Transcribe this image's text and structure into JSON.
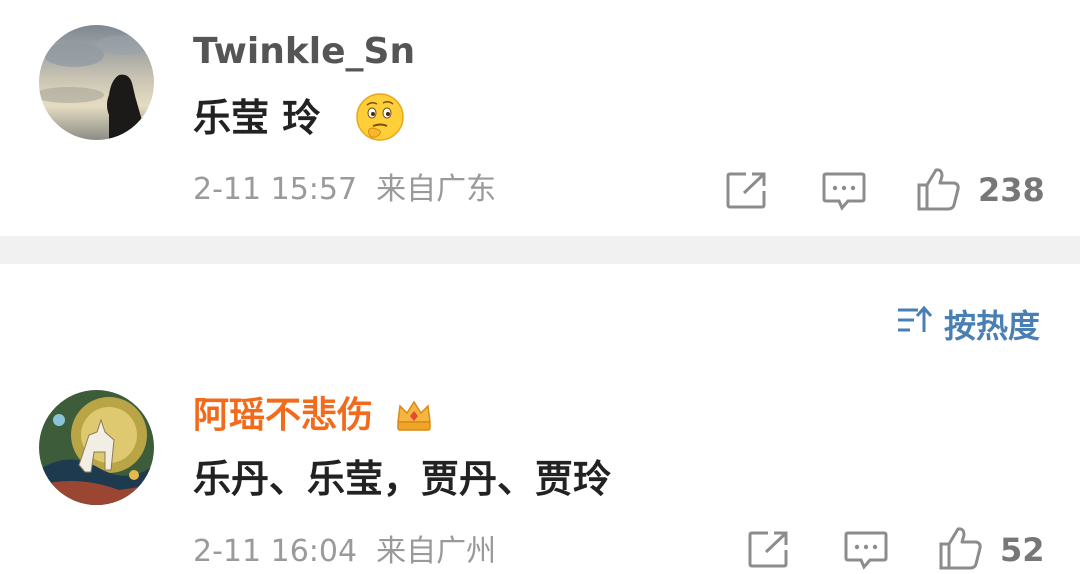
{
  "comments": [
    {
      "username": "Twinkle_Sn",
      "text": "乐莹  玲",
      "emoji": "thinking-face-icon",
      "timestamp": "2-11 15:57",
      "location": "来自广东",
      "like_count": "238"
    },
    {
      "username": "阿瑶不悲伤",
      "badge": "vip-crown-icon",
      "text": "乐丹、乐莹，贾丹、贾玲",
      "timestamp": "2-11 16:04",
      "location": "来自广州",
      "like_count": "52"
    }
  ],
  "sort": {
    "label": "按热度",
    "icon": "sort-icon"
  },
  "colors": {
    "username_orange": "#f26a1b",
    "sort_blue": "#4a7fb3",
    "meta_gray": "#9a9a9a",
    "divider_gray": "#f1f1f1"
  }
}
